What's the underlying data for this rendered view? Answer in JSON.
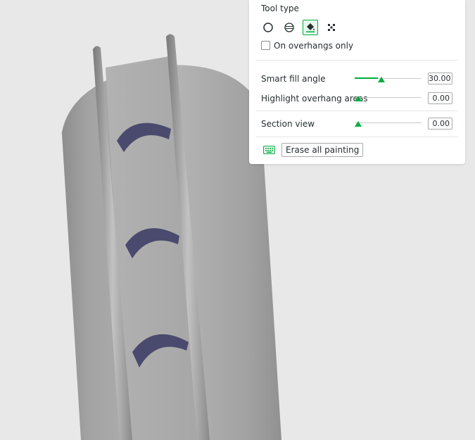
{
  "panel": {
    "tool_type_label": "Tool type",
    "tools": [
      {
        "name": "circle",
        "icon": "circle-icon"
      },
      {
        "name": "sphere",
        "icon": "sphere-icon"
      },
      {
        "name": "fill",
        "icon": "fill-bucket-icon",
        "active": true
      },
      {
        "name": "gap-fill",
        "icon": "gap-fill-icon"
      }
    ],
    "overhangs_only_label": "On overhangs only",
    "overhangs_only_checked": false,
    "smart_fill_angle": {
      "label": "Smart fill angle",
      "value": "30.00",
      "fraction": 0.35
    },
    "highlight_overhang": {
      "label": "Highlight overhang areas",
      "value": "0.00",
      "fraction": 0.0
    },
    "section_view": {
      "label": "Section view",
      "value": "0.00",
      "fraction": 0.0
    },
    "erase_label": "Erase all painting",
    "accent_color": "#00ae42"
  },
  "viewport": {
    "object_color": "#a8a8a8",
    "painted_color": "#4a4a6e",
    "background_color": "#e8e8e8"
  }
}
